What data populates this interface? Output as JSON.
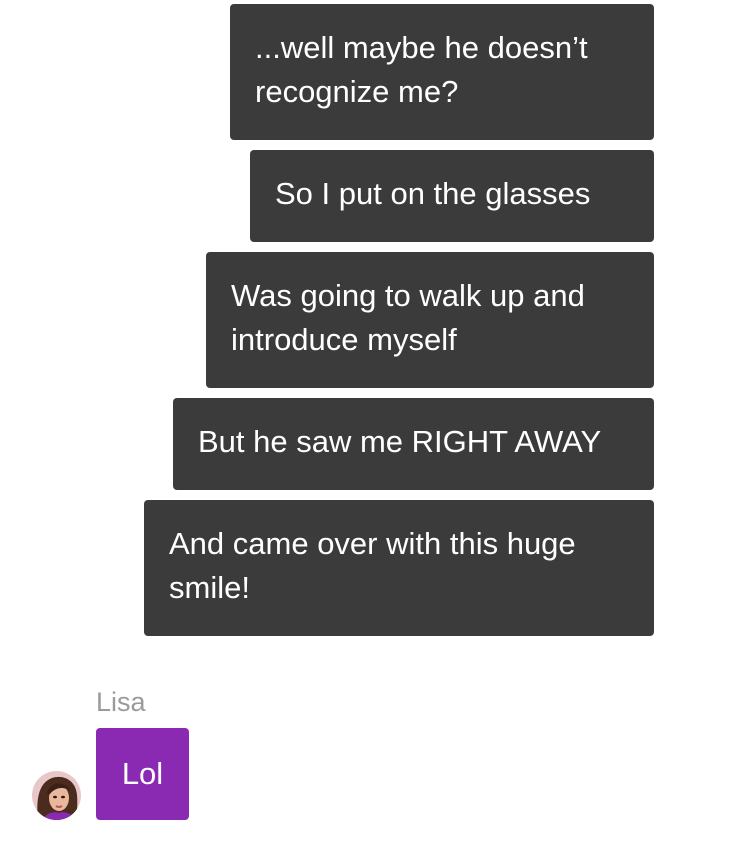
{
  "messages_sent": [
    {
      "text": "...well maybe he doesn’t recognize me?"
    },
    {
      "text": "So I put on the glasses"
    },
    {
      "text": "Was going to walk up and introduce myself"
    },
    {
      "text": "But he saw me RIGHT AWAY"
    },
    {
      "text": "And came over with this huge smile!"
    }
  ],
  "incoming": {
    "sender_name": "Lisa",
    "message": "Lol",
    "avatar_icon": "avatar-woman-portrait"
  },
  "colors": {
    "sent_bubble": "#3b3b3b",
    "received_bubble": "#8a2ab3",
    "sender_name": "#9a9a9a",
    "background": "#ffffff"
  }
}
